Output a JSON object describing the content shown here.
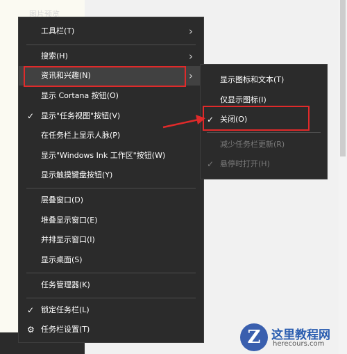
{
  "background": {
    "hint": "图片预览"
  },
  "menu": {
    "items": [
      {
        "label": "工具栏(T)",
        "submenu": true
      },
      {
        "label": "搜索(H)",
        "submenu": true
      },
      {
        "label": "资讯和兴趣(N)",
        "submenu": true,
        "highlighted": true
      },
      {
        "label": "显示 Cortana 按钮(O)"
      },
      {
        "label": "显示\"任务视图\"按钮(V)",
        "checked": true
      },
      {
        "label": "在任务栏上显示人脉(P)"
      },
      {
        "label": "显示\"Windows Ink 工作区\"按钮(W)"
      },
      {
        "label": "显示触摸键盘按钮(Y)"
      },
      {
        "label": "层叠窗口(D)"
      },
      {
        "label": "堆叠显示窗口(E)"
      },
      {
        "label": "并排显示窗口(I)"
      },
      {
        "label": "显示桌面(S)"
      },
      {
        "label": "任务管理器(K)"
      },
      {
        "label": "锁定任务栏(L)",
        "checked": true
      },
      {
        "label": "任务栏设置(T)",
        "icon": "gear-icon"
      }
    ],
    "check_glyph": "✓",
    "chevron_glyph": "›",
    "gear_glyph": "⚙"
  },
  "submenu": {
    "items": [
      {
        "label": "显示图标和文本(T)"
      },
      {
        "label": "仅显示图标(I)"
      },
      {
        "label": "关闭(O)",
        "checked": true
      },
      {
        "label": "减少任务栏更新(R)",
        "disabled": true
      },
      {
        "label": "悬停时打开(H)",
        "disabled": true,
        "checked": true
      }
    ]
  },
  "watermark": {
    "title": "这里教程网",
    "subtitle": "herecours.com",
    "logo_letter": "Z"
  },
  "colors": {
    "menu_bg": "#2b2b2b",
    "highlight": "#414141",
    "annotation_red": "#e02a2a",
    "disabled_text": "#7a7a7a"
  }
}
